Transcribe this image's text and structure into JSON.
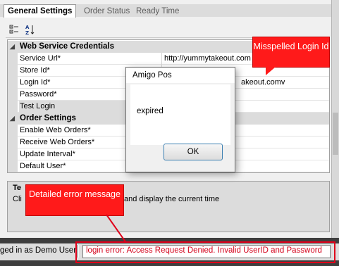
{
  "tabs": [
    {
      "label": "General Settings",
      "active": true
    },
    {
      "label": "Order Status",
      "active": false
    },
    {
      "label": "Ready Time",
      "active": false
    }
  ],
  "toolbar": {
    "categorized_icon": "categorized-icon",
    "alphabetical_icon": "alphabetical-sort-icon"
  },
  "grid": {
    "categories": [
      {
        "label": "Web Service Credentials",
        "rows": [
          {
            "name": "Service Url*",
            "value": "http://yummytakeout.com"
          },
          {
            "name": "Store Id*",
            "value": ""
          },
          {
            "name": "Login Id*",
            "value": "akeout.comv"
          },
          {
            "name": "Password*",
            "value": ""
          },
          {
            "name": "Test Login",
            "value": ""
          }
        ]
      },
      {
        "label": "Order Settings",
        "rows": [
          {
            "name": "Enable Web Orders*",
            "value": ""
          },
          {
            "name": "Receive Web Orders*",
            "value": ""
          },
          {
            "name": "Update Interval*",
            "value": ""
          },
          {
            "name": "Default User*",
            "value": ""
          }
        ]
      }
    ]
  },
  "description": {
    "title": "Te",
    "text": "Cli",
    "text_tail": "and display the current time"
  },
  "statusbar": {
    "user": "ged in as Demo User",
    "error": "login error: Access Request Denied. Invalid UserID and Password"
  },
  "dialog": {
    "title": "Amigo Pos",
    "message": "expired",
    "ok_label": "OK"
  },
  "annotations": {
    "login_callout": "Misspelled Login Id",
    "detail_callout": "Detailed error message"
  },
  "colors": {
    "annotation": "#ff1a1a",
    "error_text": "#d4001a",
    "button_border": "#3c7fb1"
  }
}
